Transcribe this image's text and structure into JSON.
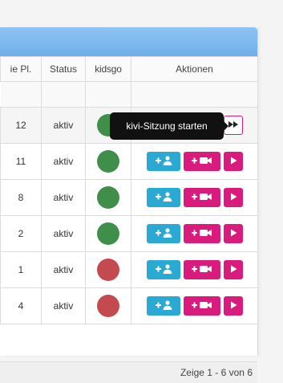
{
  "columns": {
    "places": "ie Pl.",
    "status": "Status",
    "brand": "kidsgo",
    "actions": "Aktionen"
  },
  "rows": [
    {
      "places": "12",
      "status": "aktiv",
      "indicator": "green"
    },
    {
      "places": "11",
      "status": "aktiv",
      "indicator": "green"
    },
    {
      "places": "8",
      "status": "aktiv",
      "indicator": "green"
    },
    {
      "places": "2",
      "status": "aktiv",
      "indicator": "green"
    },
    {
      "places": "1",
      "status": "aktiv",
      "indicator": "red"
    },
    {
      "places": "4",
      "status": "aktiv",
      "indicator": "red"
    }
  ],
  "icons": {
    "add_user": "add-user-icon",
    "add_video": "add-video-icon",
    "play": "play-icon",
    "fast_forward": "fast-forward-icon"
  },
  "colors": {
    "header_blue": "#7ab7ee",
    "brand_blue": "#1e73be",
    "cyan_button": "#2aa9d2",
    "magenta_button": "#d81b7c",
    "indicator_green": "#3f8f4a",
    "indicator_red": "#c34a4f"
  },
  "tooltip": {
    "text": "kivi-Sitzung starten"
  },
  "pagination": {
    "text": "Zeige 1 - 6 von 6"
  }
}
